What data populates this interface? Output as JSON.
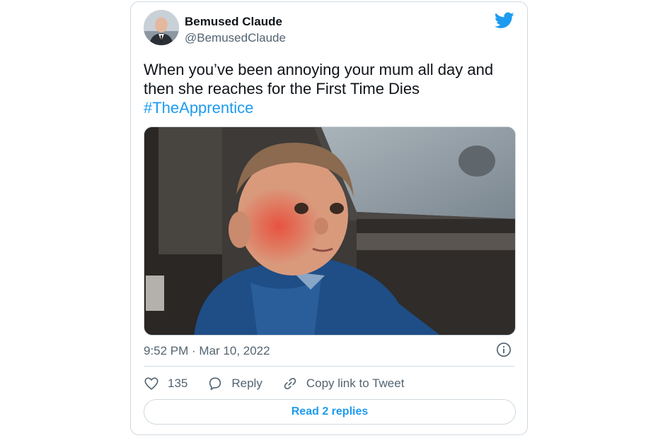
{
  "tweet": {
    "author_name": "Bemused Claude",
    "author_handle": "@BemusedClaude",
    "text_line1": "When you’ve been annoying your mum all day and",
    "text_line2": "then she reaches for the First Time Dies",
    "hashtag": "#TheApprentice",
    "timestamp": "9:52 PM · Mar 10, 2022"
  },
  "actions": {
    "like_count": "135",
    "reply_label": "Reply",
    "copy_label": "Copy link to Tweet"
  },
  "replies_button_label": "Read 2 replies",
  "icons": {
    "brand": "twitter-bird-icon",
    "like": "heart-icon",
    "reply": "speech-bubble-icon",
    "copy": "link-icon",
    "info": "info-icon"
  },
  "colors": {
    "accent": "#1d9bf0",
    "text": "#0f1419",
    "muted": "#536471",
    "border": "#cfd9de"
  }
}
